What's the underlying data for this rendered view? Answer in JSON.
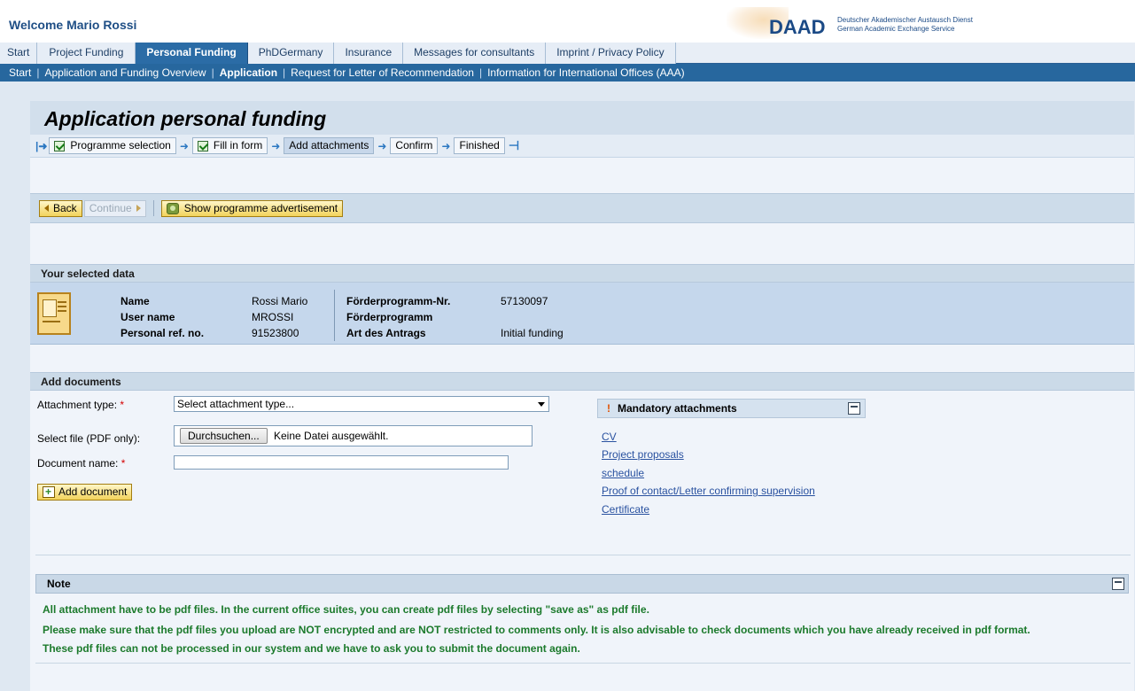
{
  "header": {
    "welcome": "Welcome Mario Rossi",
    "logo_text": "DAAD",
    "logo_sub_line1": "Deutscher Akademischer Austausch Dienst",
    "logo_sub_line2": "German Academic Exchange Service"
  },
  "tabs": [
    {
      "label": "Start",
      "active": false
    },
    {
      "label": "Project Funding",
      "active": false
    },
    {
      "label": "Personal Funding",
      "active": true
    },
    {
      "label": "PhDGermany",
      "active": false
    },
    {
      "label": "Insurance",
      "active": false
    },
    {
      "label": "Messages for consultants",
      "active": false
    },
    {
      "label": "Imprint / Privacy Policy",
      "active": false
    }
  ],
  "subnav": [
    "Start",
    "Application and Funding Overview",
    "Application",
    "Request for Letter of Recommendation",
    "Information for International Offices (AAA)"
  ],
  "page_title": "Application personal funding",
  "roadmap": [
    {
      "label": "Programme selection",
      "done": true
    },
    {
      "label": "Fill in form",
      "done": true
    },
    {
      "label": "Add attachments",
      "current": true
    },
    {
      "label": "Confirm"
    },
    {
      "label": "Finished"
    }
  ],
  "toolbar": {
    "back": "Back",
    "continue": "Continue",
    "show_ad": "Show programme advertisement"
  },
  "selected_data": {
    "heading": "Your selected data",
    "name_label": "Name",
    "name_value": "Rossi Mario",
    "user_label": "User name",
    "user_value": "MROSSI",
    "ref_label": "Personal ref. no.",
    "ref_value": "91523800",
    "prog_nr_label": "Förderprogramm-Nr.",
    "prog_nr_value": "57130097",
    "prog_label": "Förderprogramm",
    "prog_value": "",
    "art_label": "Art des Antrags",
    "art_value": "Initial funding"
  },
  "documents": {
    "heading": "Add documents",
    "type_label": "Attachment type:",
    "type_value": "Select attachment type...",
    "file_label": "Select file (PDF only):",
    "file_button": "Durchsuchen...",
    "file_status": "Keine Datei ausgewählt.",
    "name_label": "Document name:",
    "name_value": "",
    "add_button": "Add document",
    "required_mark": "*"
  },
  "mandatory": {
    "heading": "Mandatory attachments",
    "items": [
      "CV",
      "Project proposals",
      "schedule",
      "Proof of contact/Letter confirming supervision",
      "Certificate"
    ]
  },
  "note": {
    "heading": "Note",
    "lines": [
      "All attachment have to be pdf files. In the current office suites, you can create pdf files by selecting \"save as\" as pdf file.",
      "Please make sure that the pdf files you upload are NOT encrypted and are NOT restricted to comments only. It is also advisable to check documents which you have already received in pdf format.",
      "These pdf files can not be processed in our system and we have to ask you to submit the document again."
    ]
  },
  "colors": {
    "nav_blue": "#27679e",
    "active_tab": "#2b6ca6",
    "note_green": "#1c7a2c",
    "required_red": "#d40000"
  }
}
